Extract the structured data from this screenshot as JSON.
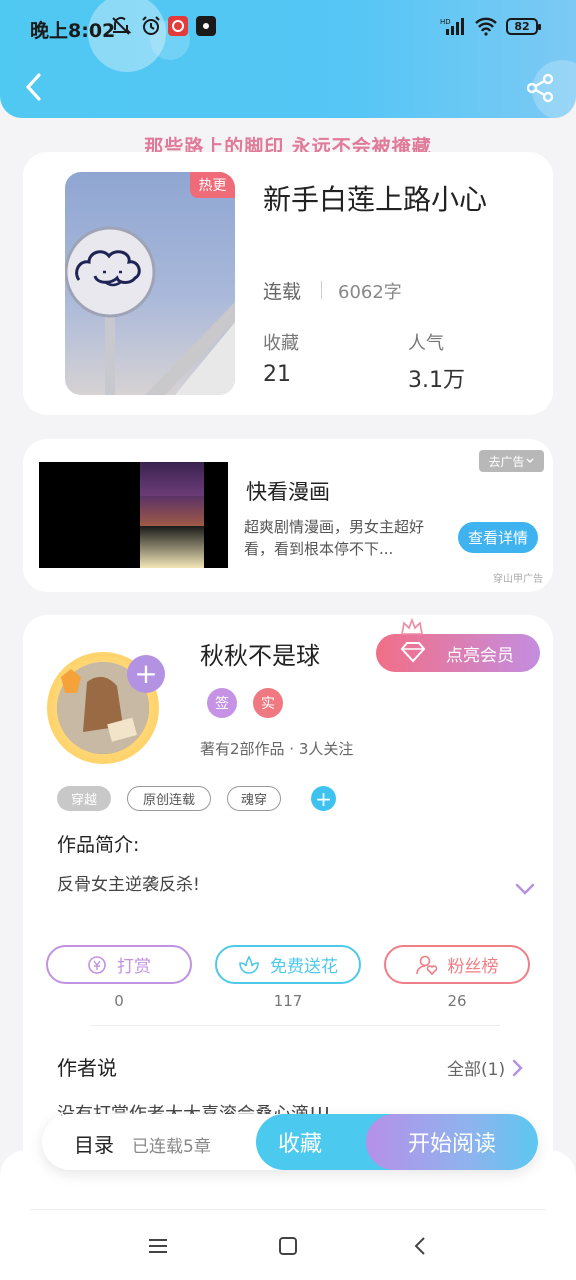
{
  "status_bar": {
    "time": "晚上8:02",
    "battery": "82",
    "icons": [
      "mute-icon",
      "alarm-icon",
      "netease-music-icon",
      "app-icon",
      "hd-signal-icon",
      "wifi-icon",
      "battery-icon"
    ]
  },
  "header": {
    "back_icon": "back-arrow-icon",
    "share_icon": "share-icon",
    "slogan": "那些路上的脚印 永远不会被掩藏"
  },
  "book": {
    "hot_badge": "热更",
    "title": "新手白莲上路小心",
    "status": "连载",
    "word_count": "6062字",
    "stats": [
      {
        "label": "收藏",
        "value": "21"
      },
      {
        "label": "人气",
        "value": "3.1万"
      }
    ]
  },
  "ad": {
    "title": "快看漫画",
    "description": "超爽剧情漫画，男女主超好看，看到根本停不下...",
    "close_label": "去广告",
    "cta": "查看详情",
    "source": "穿山甲广告"
  },
  "author": {
    "name": "秋秋不是球",
    "badges": [
      {
        "label": "签",
        "color": "#c592e6"
      },
      {
        "label": "实",
        "color": "#f07880"
      }
    ],
    "meta": "著有2部作品 · 3人关注",
    "vip_button": "点亮会员",
    "tags": [
      "穿越",
      "原创连载",
      "魂穿"
    ],
    "intro_label": "作品简介:",
    "intro_text": "反骨女主逆袭反杀!",
    "actions": [
      {
        "label": "打赏",
        "icon": "coin-icon",
        "color": "#c192e2",
        "count": "0"
      },
      {
        "label": "免费送花",
        "icon": "flower-icon",
        "color": "#4fc9ea",
        "count": "117"
      },
      {
        "label": "粉丝榜",
        "icon": "fan-rank-icon",
        "color": "#ef7e86",
        "count": "26"
      }
    ],
    "says_label": "作者说",
    "all_label": "全部(1)",
    "says_preview": "没有打赏作者大大喜滚会桑心滴!!!"
  },
  "bottom_bar": {
    "toc": "目录",
    "chapters": "已连载5章",
    "collect": "收藏",
    "read": "开始阅读"
  },
  "nav": {
    "icons": [
      "menu-icon",
      "home-square-icon",
      "back-triangle-icon"
    ]
  }
}
